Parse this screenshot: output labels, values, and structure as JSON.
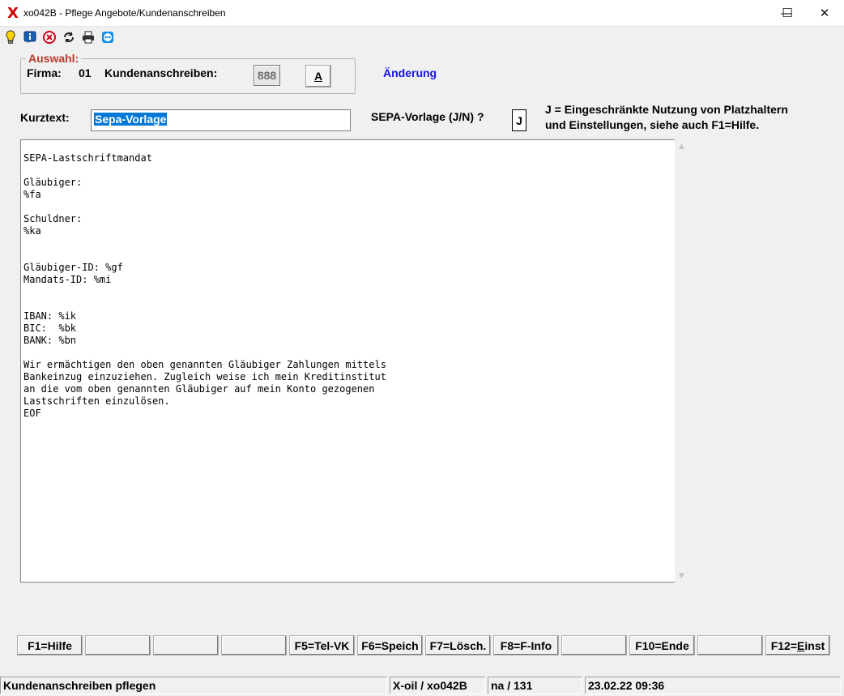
{
  "window": {
    "app_mark": "X",
    "title": "xo042B - Pflege Angebote/Kundenanschreiben",
    "minimize_glyph": "—",
    "maximize_glyph": "☐",
    "close_glyph": "✕"
  },
  "toolbar": {
    "icons": [
      "lightbulb-icon",
      "info-icon",
      "cancel-icon",
      "refresh-icon",
      "print-icon",
      "teamviewer-icon"
    ]
  },
  "selection": {
    "legend": "Auswahl:",
    "firma_label": "Firma:",
    "firma_value": "01",
    "kundenanschreiben_label": "Kundenanschreiben:",
    "number": "888",
    "mode_button": "A"
  },
  "mode_status": "Änderung",
  "form": {
    "kurztext_label": "Kurztext:",
    "kurztext_value": "Sepa-Vorlage",
    "sepa_label": "SEPA-Vorlage (J/N) ?",
    "sepa_value": "J",
    "hint": "J = Eingeschränkte Nutzung von Platzhaltern\nund Einstellungen, siehe auch F1=Hilfe."
  },
  "editor": {
    "text": "SEPA-Lastschriftmandat\n\nGläubiger:\n%fa\n\nSchuldner:\n%ka\n\n\nGläubiger-ID: %gf\nMandats-ID: %mi\n\n\nIBAN: %ik\nBIC:  %bk\nBANK: %bn\n\nWir ermächtigen den oben genannten Gläubiger Zahlungen mittels\nBankeinzug einzuziehen. Zugleich weise ich mein Kreditinstitut\nan die vom oben genannten Gläubiger auf mein Konto gezogenen\nLastschriften einzulösen.\nEOF"
  },
  "function_keys": {
    "f1": "F1=Hilfe",
    "f2": "",
    "f3": "",
    "f4": "",
    "f5": "F5=Tel-VK",
    "f6": "F6=Speich",
    "f7": "F7=Lösch.",
    "f8": "F8=F-Info",
    "f9": "",
    "f10": "F10=Ende",
    "f11": "",
    "f12_prefix": "F12=",
    "f12_underlined": "E",
    "f12_suffix": "inst"
  },
  "statusbar": {
    "message": "Kundenanschreiben pflegen",
    "program": "X-oil / xo042B",
    "user": "na / 131",
    "datetime": "23.02.22 09:36"
  },
  "colors": {
    "legend": "#c0392b",
    "mode_status": "#1414e6",
    "selection_highlight": "#0078d7",
    "app_mark": "#d40000"
  }
}
